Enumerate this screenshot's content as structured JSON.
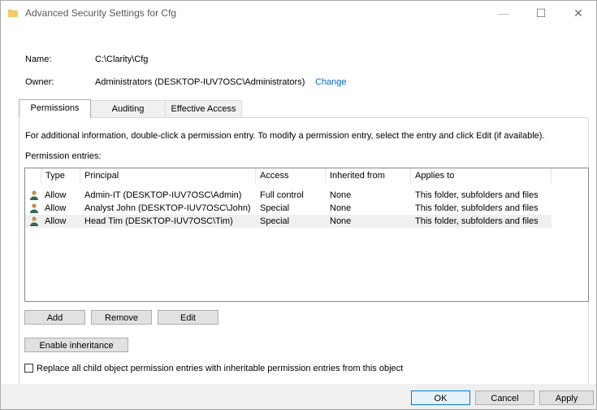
{
  "window": {
    "title": "Advanced Security Settings for Cfg",
    "controls": {
      "minimize": "—",
      "maximize": "☐",
      "close": "✕"
    }
  },
  "info": {
    "name_label": "Name:",
    "name_value": "C:\\Clarity\\Cfg",
    "owner_label": "Owner:",
    "owner_value": "Administrators (DESKTOP-IUV7OSC\\Administrators)",
    "change_link": "Change"
  },
  "tabs": [
    {
      "label": "Permissions",
      "active": true
    },
    {
      "label": "Auditing",
      "active": false
    },
    {
      "label": "Effective Access",
      "active": false
    }
  ],
  "instructions": "For additional information, double-click a permission entry. To modify a permission entry, select the entry and click Edit (if available).",
  "entries_label": "Permission entries:",
  "columns": [
    "Type",
    "Principal",
    "Access",
    "Inherited from",
    "Applies to"
  ],
  "entries": [
    {
      "type": "Allow",
      "principal": "Admin-IT (DESKTOP-IUV7OSC\\Admin)",
      "access": "Full control",
      "inherited_from": "None",
      "applies_to": "This folder, subfolders and files"
    },
    {
      "type": "Allow",
      "principal": "Analyst John (DESKTOP-IUV7OSC\\John)",
      "access": "Special",
      "inherited_from": "None",
      "applies_to": "This folder, subfolders and files"
    },
    {
      "type": "Allow",
      "principal": "Head Tim (DESKTOP-IUV7OSC\\Tim)",
      "access": "Special",
      "inherited_from": "None",
      "applies_to": "This folder, subfolders and files"
    }
  ],
  "buttons": {
    "add": "Add",
    "remove": "Remove",
    "edit": "Edit",
    "enable_inheritance": "Enable inheritance",
    "ok": "OK",
    "cancel": "Cancel",
    "apply": "Apply"
  },
  "replace_checkbox": {
    "label": "Replace all child object permission entries with inheritable permission entries from this object",
    "checked": false
  },
  "colors": {
    "link": "#0066cc",
    "user_icon_head": "#c98b4a",
    "user_icon_body": "#2e6b4f",
    "folder": "#e8b84a"
  }
}
